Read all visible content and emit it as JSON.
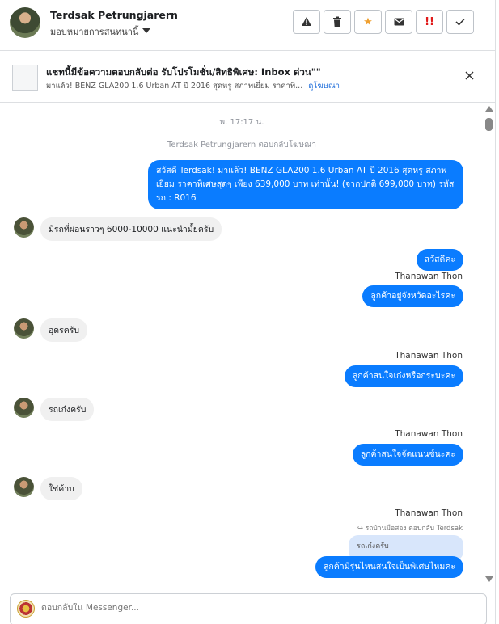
{
  "header": {
    "name": "Terdsak Petrungjarern",
    "assign_label": "มอบหมายการสนทนานี้",
    "actions": [
      "spam",
      "delete",
      "star",
      "mark-unread",
      "urgent",
      "done"
    ]
  },
  "ad": {
    "title": "แชทนี้มีข้อความตอบกลับต่อ รับโปรโมชั่น/สิทธิพิเศษ: Inbox ด่วน\"\"",
    "subtitle": "มาแล้ว! BENZ GLA200 1.6 Urban AT ปี 2016 สุดหรู สภาพเยี่ยม ราคาพิ...",
    "link": "ดูโฆษณา"
  },
  "conversation": {
    "timestamp": "พ. 17:17 น.",
    "system_note": "Terdsak Petrungjarern ตอบกลับโฆษณา",
    "outgoing_ad": "สวัสดี Terdsak! มาแล้ว! BENZ GLA200 1.6 Urban AT ปี 2016 สุดหรู สภาพเยี่ยม ราคาพิเศษสุดๆ เพียง 639,000 บาท เท่านั้น! (จากปกติ 699,000 บาท) รหัสรถ : R016",
    "messages": [
      {
        "from": "customer",
        "text": "มีรถที่ผ่อนราวๆ 6000-10000 แนะนำมั้ยครับ"
      },
      {
        "from": "page",
        "text": "สวัสดีคะ"
      },
      {
        "from": "page",
        "sender": "Thanawan Thon",
        "text": "ลูกค้าอยู่จังหวัดอะไรคะ"
      },
      {
        "from": "customer",
        "text": "อุดรครับ"
      },
      {
        "from": "page",
        "sender": "Thanawan Thon",
        "text": "ลูกค้าสนใจเก๋งหรือกระบะคะ"
      },
      {
        "from": "customer",
        "text": "รถเก๋งครับ"
      },
      {
        "from": "page",
        "sender": "Thanawan Thon",
        "text": "ลูกค้าสนใจจัดแนนซ์นะคะ"
      },
      {
        "from": "customer",
        "text": "ใช่ค้าบ"
      },
      {
        "from": "page",
        "sender": "Thanawan Thon",
        "reply_note": "รถบ้านมือสอง ตอบกลับ Terdsak",
        "quoted": "รถเก๋งครับ",
        "text": "ลูกค้ามีรุ่นไหนสนใจเป็นพิเศษไหมคะ"
      }
    ]
  },
  "composer": {
    "placeholder": "ตอบกลับใน Messenger..."
  }
}
